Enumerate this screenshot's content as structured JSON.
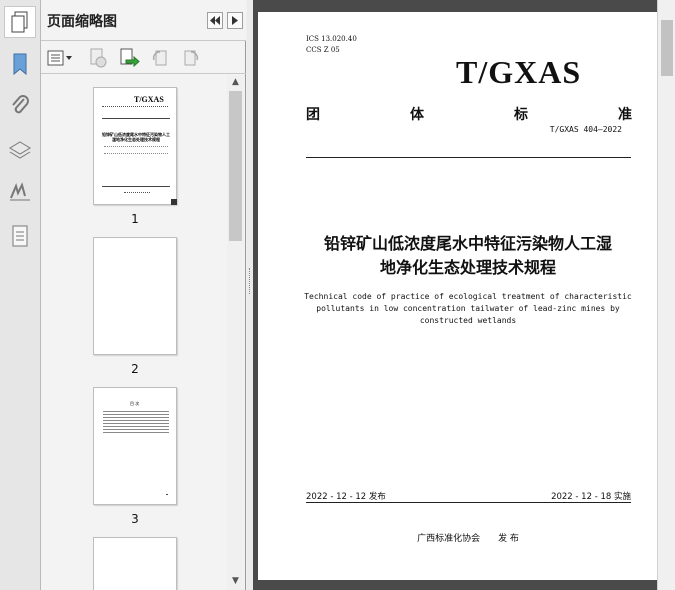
{
  "panel": {
    "title": "页面缩略图"
  },
  "thumbnails": [
    {
      "page_number": "1",
      "mini_logo": "T/GXAS",
      "mini_title": "铅锌矿山低浓度尾水中特征污染物人工湿地净化生态处理技术规程"
    },
    {
      "page_number": "2"
    },
    {
      "page_number": "3",
      "mini_heading": "目 次"
    },
    {
      "page_number": ""
    }
  ],
  "document": {
    "ics": "ICS  13.020.40",
    "ccs": "CCS  Z 05",
    "logo": "T/GXAS",
    "standard_type": [
      "团",
      "体",
      "标",
      "准"
    ],
    "standard_code": "T/GXAS 404—2022",
    "title_line1": "铅锌矿山低浓度尾水中特征污染物人工湿",
    "title_line2": "地净化生态处理技术规程",
    "title_en_line1": "Technical code of practice of ecological treatment of characteristic",
    "title_en_line2": "pollutants in low concentration tailwater of lead-zinc mines by",
    "title_en_line3": "constructed wetlands",
    "publish_date": "2022 - 12 - 12 发布",
    "implement_date": "2022 - 12 - 18 实施",
    "publisher": "广西标准化协会　　发 布"
  }
}
